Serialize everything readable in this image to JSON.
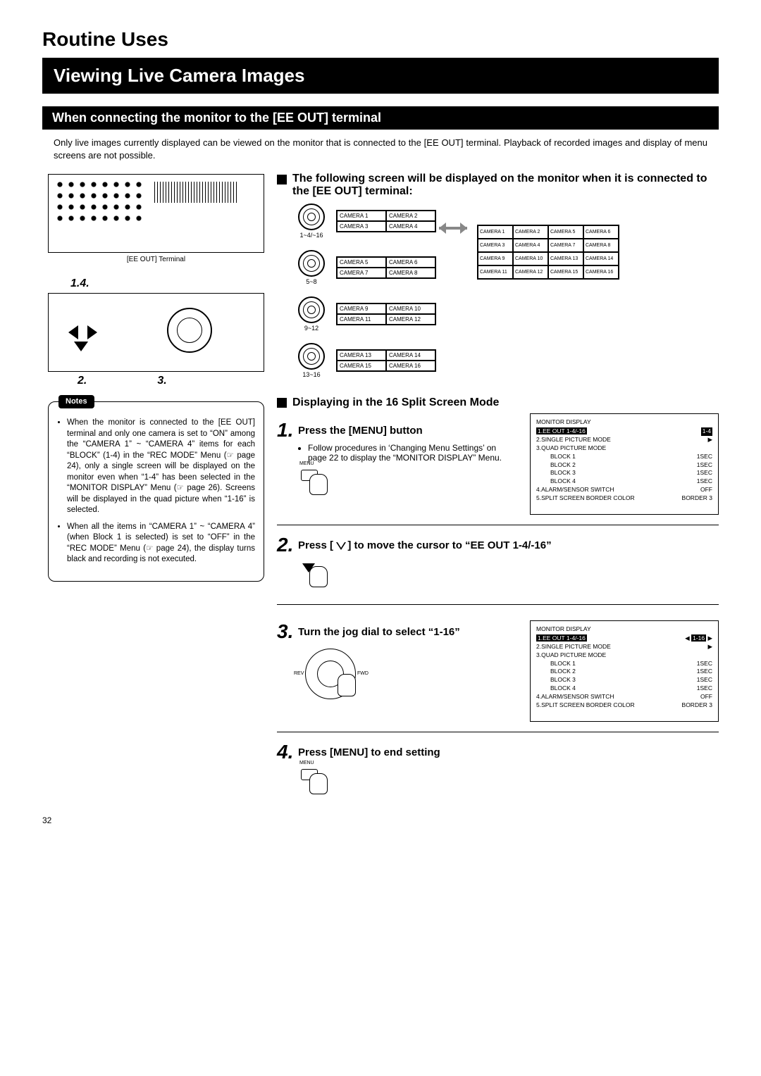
{
  "chapter": "Routine Uses",
  "title": "Viewing Live Camera Images",
  "subtitle": "When connecting the monitor to the [EE OUT] terminal",
  "intro": "Only live images currently displayed can be viewed on the monitor that is connected to the [EE OUT] terminal. Playback of recorded images and display of menu screens are not possible.",
  "terminal_label": "[EE OUT] Terminal",
  "front_num_top": "1.4.",
  "front_num_2": "2.",
  "front_num_3": "3.",
  "notes_badge": "Notes",
  "notes": [
    "When the monitor is connected to the [EE OUT] terminal and only one camera is set to “ON” among the “CAMERA 1” ~ “CAMERA 4” items for each “BLOCK” (1-4) in the “REC MODE” Menu (☞ page 24), only a single screen will be displayed on the monitor even when “1-4” has been selected in the “MONITOR DISPLAY” Menu (☞ page 26). Screens will be displayed in the quad picture when “1-16” is selected.",
    "When all the items in “CAMERA 1” ~ “CAMERA 4” (when Block 1 is selected) is set to “OFF” in the “REC MODE” Menu (☞ page 24), the display turns black and recording is not executed."
  ],
  "right_block_head": "The following screen will be displayed on the monitor when it is connected to the [EE OUT] terminal:",
  "dial_labels": [
    "1~4/~16",
    "5~8",
    "9~12",
    "13~16"
  ],
  "quads": [
    [
      "CAMERA 1",
      "CAMERA 2",
      "CAMERA 3",
      "CAMERA 4"
    ],
    [
      "CAMERA 5",
      "CAMERA 6",
      "CAMERA 7",
      "CAMERA 8"
    ],
    [
      "CAMERA 9",
      "CAMERA 10",
      "CAMERA 11",
      "CAMERA 12"
    ],
    [
      "CAMERA 13",
      "CAMERA 14",
      "CAMERA 15",
      "CAMERA 16"
    ]
  ],
  "sixteen_rows": [
    [
      "CAMERA 1",
      "CAMERA 2",
      "CAMERA 5",
      "CAMERA 6"
    ],
    [
      "CAMERA 3",
      "CAMERA 4",
      "CAMERA 7",
      "CAMERA 8"
    ],
    [
      "CAMERA 9",
      "CAMERA 10",
      "CAMERA 13",
      "CAMERA 14"
    ],
    [
      "CAMERA 11",
      "CAMERA 12",
      "CAMERA 15",
      "CAMERA 16"
    ]
  ],
  "section_head": "Displaying in the 16 Split Screen Mode",
  "step1_title": "Press the [MENU] button",
  "step1_body": "Follow procedures in ‘Changing Menu Settings’ on page 22 to display the “MONITOR DISPLAY” Menu.",
  "menu_label": "MENU",
  "step2_title_a": "Press [ ",
  "step2_title_b": " ] to move the cursor to “EE OUT 1-4/-16”",
  "step3_title": "Turn the jog dial to select “1-16”",
  "step4_title": "Press [MENU] to end setting",
  "jog_rev": "REV",
  "jog_fwd": "FWD",
  "menu1": {
    "header": "MONITOR DISPLAY",
    "r1a": "1.EE OUT 1-4/-16",
    "r1b": "1-4",
    "r2": "2.SINGLE PICTURE MODE",
    "r2b": "▶",
    "r3": "3.QUAD PICTURE MODE",
    "b1a": "BLOCK 1",
    "b1b": "1SEC",
    "b2a": "BLOCK 2",
    "b2b": "1SEC",
    "b3a": "BLOCK 3",
    "b3b": "1SEC",
    "b4a": "BLOCK 4",
    "b4b": "1SEC",
    "r4a": "4.ALARM/SENSOR SWITCH",
    "r4b": "OFF",
    "r5a": "5.SPLIT SCREEN BORDER COLOR",
    "r5b": "BORDER 3"
  },
  "menu2": {
    "header": "MONITOR DISPLAY",
    "r1a": "1.EE OUT 1-4/-16",
    "r1b": "1-16",
    "r2": "2.SINGLE PICTURE MODE",
    "r2b": "▶",
    "r3": "3.QUAD PICTURE MODE",
    "b1a": "BLOCK 1",
    "b1b": "1SEC",
    "b2a": "BLOCK 2",
    "b2b": "1SEC",
    "b3a": "BLOCK 3",
    "b3b": "1SEC",
    "b4a": "BLOCK 4",
    "b4b": "1SEC",
    "r4a": "4.ALARM/SENSOR SWITCH",
    "r4b": "OFF",
    "r5a": "5.SPLIT SCREEN BORDER COLOR",
    "r5b": "BORDER 3"
  },
  "page_number": "32"
}
